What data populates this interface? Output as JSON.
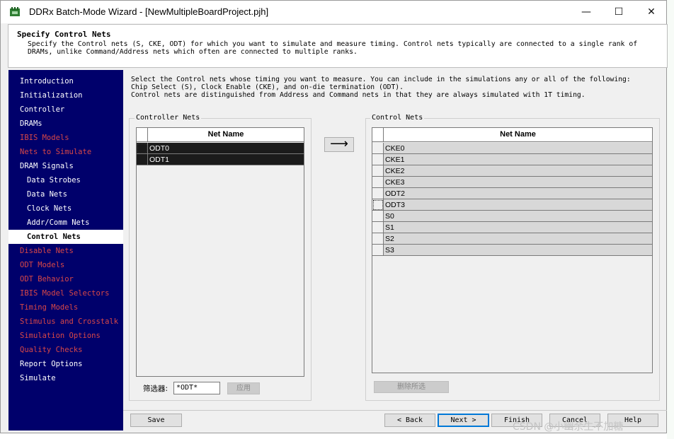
{
  "window": {
    "title": "DDRx Batch-Mode Wizard - [NewMultipleBoardProject.pjh]"
  },
  "title_buttons": {
    "minimize": "—",
    "maximize": "☐",
    "close": "✕"
  },
  "header": {
    "title": "Specify Control Nets",
    "line1": "Specify the Control nets (S, CKE, ODT) for which you want to simulate and measure timing.  Control nets typically are connected to a single rank of",
    "line2": "DRAMs, unlike Command/Address nets which often are connected to multiple ranks."
  },
  "nav": [
    {
      "label": "Introduction",
      "state": "white",
      "indent": 0
    },
    {
      "label": "Initialization",
      "state": "white",
      "indent": 0
    },
    {
      "label": "Controller",
      "state": "white",
      "indent": 0
    },
    {
      "label": "DRAMs",
      "state": "white",
      "indent": 0
    },
    {
      "label": "IBIS Models",
      "state": "red",
      "indent": 0
    },
    {
      "label": "Nets to Simulate",
      "state": "red",
      "indent": 0
    },
    {
      "label": "DRAM Signals",
      "state": "white",
      "indent": 0
    },
    {
      "label": "Data Strobes",
      "state": "white",
      "indent": 1
    },
    {
      "label": "Data Nets",
      "state": "white",
      "indent": 1
    },
    {
      "label": "Clock Nets",
      "state": "white",
      "indent": 1
    },
    {
      "label": "Addr/Comm Nets",
      "state": "white",
      "indent": 1
    },
    {
      "label": "Control Nets",
      "state": "active",
      "indent": 1
    },
    {
      "label": "Disable Nets",
      "state": "red",
      "indent": 0
    },
    {
      "label": "ODT Models",
      "state": "red",
      "indent": 0
    },
    {
      "label": "ODT Behavior",
      "state": "red",
      "indent": 0
    },
    {
      "label": "IBIS Model Selectors",
      "state": "red",
      "indent": 0
    },
    {
      "label": "Timing Models",
      "state": "red",
      "indent": 0
    },
    {
      "label": "Stimulus and Crosstalk",
      "state": "red",
      "indent": 0
    },
    {
      "label": "Simulation Options",
      "state": "red",
      "indent": 0
    },
    {
      "label": "Quality Checks",
      "state": "red",
      "indent": 0
    },
    {
      "label": "Report Options",
      "state": "white",
      "indent": 0
    },
    {
      "label": "Simulate",
      "state": "white",
      "indent": 0
    }
  ],
  "intro": {
    "line1": "Select the Control nets whose timing you want to measure.  You can include in the simulations any or all of the following:",
    "line2": "Chip Select (S), Clock Enable (CKE), and on-die termination (ODT).",
    "line3": "Control nets are distinguished from Address and Command nets in that they are always simulated with 1T timing."
  },
  "controller_nets": {
    "label": "Controller Nets",
    "column_header": "Net Name",
    "rows": [
      "ODT0",
      "ODT1"
    ]
  },
  "control_nets": {
    "label": "Control Nets",
    "column_header": "Net Name",
    "rows": [
      "CKE0",
      "CKE1",
      "CKE2",
      "CKE3",
      "ODT2",
      "ODT3",
      "S0",
      "S1",
      "S2",
      "S3"
    ]
  },
  "move_button": {
    "icon": "right-arrow-icon",
    "glyph": "⟶"
  },
  "filter": {
    "label": "筛选器:",
    "value": "*ODT*",
    "apply_label": "应用"
  },
  "delete_selected_label": "删除所选",
  "footer": {
    "save": "Save",
    "back": "< Back",
    "next": "Next >",
    "finish": "Finish",
    "cancel": "Cancel",
    "help": "Help"
  },
  "watermark": "CSDN @小幽余生不加糖"
}
